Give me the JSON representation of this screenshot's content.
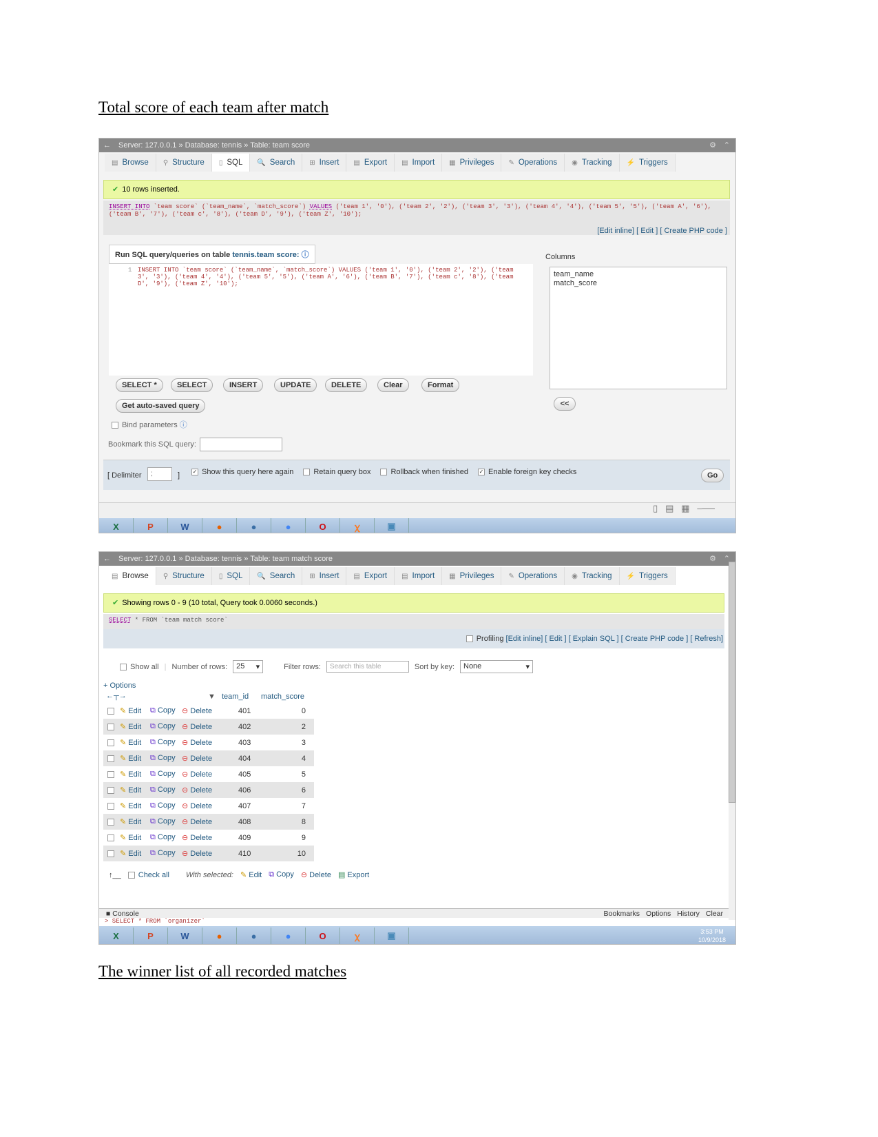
{
  "headings": [
    "Total score of each team after match",
    "The winner list of all recorded matches"
  ],
  "tabs": [
    {
      "label": "Browse",
      "icon": "browse-icon",
      "g": "▤"
    },
    {
      "label": "Structure",
      "icon": "structure-icon",
      "g": "⚲"
    },
    {
      "label": "SQL",
      "icon": "sql-icon",
      "g": "▯"
    },
    {
      "label": "Search",
      "icon": "search-icon",
      "g": "🔍"
    },
    {
      "label": "Insert",
      "icon": "insert-icon",
      "g": "⊞"
    },
    {
      "label": "Export",
      "icon": "export-icon",
      "g": "▤"
    },
    {
      "label": "Import",
      "icon": "import-icon",
      "g": "▤"
    },
    {
      "label": "Privileges",
      "icon": "privileges-icon",
      "g": "▦"
    },
    {
      "label": "Operations",
      "icon": "wrench-icon",
      "g": "✎"
    },
    {
      "label": "Tracking",
      "icon": "tracking-icon",
      "g": "◉"
    },
    {
      "label": "Triggers",
      "icon": "triggers-icon",
      "g": "⚡"
    }
  ],
  "shot1": {
    "breadcrumb": "Server: 127.0.0.1 » Database: tennis » Table: team score",
    "active_tab": "SQL",
    "success": "10 rows inserted.",
    "sql_kw1": "INSERT INTO",
    "sql_mid": " `team score` (`team_name`, `match_score`) ",
    "sql_kw2": "VALUES",
    "sql_rest": " ('team 1', '0'), ('team 2', '2'), ('team 3', '3'), ('team 4', '4'), ('team 5', '5'), ('team A', '6'), ('team B', '7'), ('team c', '8'), ('team D', '9'), ('team Z', '10');",
    "links": "[Edit inline] [ Edit ] [ Create PHP code ]",
    "run_label": "Run SQL query/queries on table ",
    "run_table": "tennis.team score:",
    "editor_line": "1",
    "editor_text": "INSERT INTO `team score` (`team_name`, `match_score`) VALUES ('team 1', '0'), ('team 2', '2'), ('team 3', '3'), ('team 4', '4'), ('team 5', '5'), ('team A', '6'), ('team B', '7'), ('team c', '8'), ('team D', '9'), ('team Z', '10');",
    "columns_label": "Columns",
    "columns": [
      "team_name",
      "match_score"
    ],
    "buttons": [
      "SELECT *",
      "SELECT",
      "INSERT",
      "UPDATE",
      "DELETE",
      "Clear",
      "Format"
    ],
    "autosave": "Get auto-saved query",
    "insert_col": "<<",
    "bind_params": "Bind parameters",
    "bookmark_label": "Bookmark this SQL query:",
    "delimiter_label": "[ Delimiter",
    "delimiter_value": ";",
    "delimiter_close": "]",
    "options": [
      {
        "label": "Show this query here again",
        "checked": true
      },
      {
        "label": "Retain query box",
        "checked": false
      },
      {
        "label": "Rollback when finished",
        "checked": false
      },
      {
        "label": "Enable foreign key checks",
        "checked": true
      }
    ],
    "go": "Go"
  },
  "shot2": {
    "breadcrumb": "Server: 127.0.0.1 » Database: tennis » Table: team match score",
    "active_tab": "Browse",
    "success": "Showing rows 0 - 9 (10 total, Query took 0.0060 seconds.)",
    "sql_kw": "SELECT",
    "sql_rest": " * FROM `team match score`",
    "profiling": "Profiling",
    "links": "[Edit inline] [ Edit ] [ Explain SQL ] [ Create PHP code ] [ Refresh]",
    "show_all": "Show all",
    "num_rows_label": "Number of rows:",
    "num_rows": "25",
    "filter_label": "Filter rows:",
    "filter_placeholder": "Search this table",
    "sort_label": "Sort by key:",
    "sort_value": "None",
    "options_link": "+ Options",
    "col_headers": [
      "team_id",
      "match_score"
    ],
    "row_actions": [
      "Edit",
      "Copy",
      "Delete"
    ],
    "rows": [
      [
        "401",
        "0"
      ],
      [
        "402",
        "2"
      ],
      [
        "403",
        "3"
      ],
      [
        "404",
        "4"
      ],
      [
        "405",
        "5"
      ],
      [
        "406",
        "6"
      ],
      [
        "407",
        "7"
      ],
      [
        "408",
        "8"
      ],
      [
        "409",
        "9"
      ],
      [
        "410",
        "10"
      ]
    ],
    "check_all": "Check all",
    "with_selected": "With selected:",
    "bulk": [
      "Edit",
      "Copy",
      "Delete",
      "Export"
    ],
    "console": "Console",
    "console_links": [
      "Bookmarks",
      "Options",
      "History",
      "Clear"
    ],
    "console_text": "> SELECT * FROM `organizer`",
    "clock_time": "3:53 PM",
    "clock_date": "10/9/2018"
  },
  "taskbar_apps": [
    {
      "name": "excel",
      "g": "X",
      "c": "#1e7145"
    },
    {
      "name": "powerpoint",
      "g": "P",
      "c": "#d24726"
    },
    {
      "name": "word",
      "g": "W",
      "c": "#2b579a"
    },
    {
      "name": "firefox",
      "g": "●",
      "c": "#e66000"
    },
    {
      "name": "thunderbird",
      "g": "●",
      "c": "#3a6ea5"
    },
    {
      "name": "chrome",
      "g": "●",
      "c": "#4285f4"
    },
    {
      "name": "opera",
      "g": "O",
      "c": "#cc0f16"
    },
    {
      "name": "xampp",
      "g": "ꭓ",
      "c": "#fb7a24"
    },
    {
      "name": "photos",
      "g": "▣",
      "c": "#4a8ab8"
    }
  ]
}
